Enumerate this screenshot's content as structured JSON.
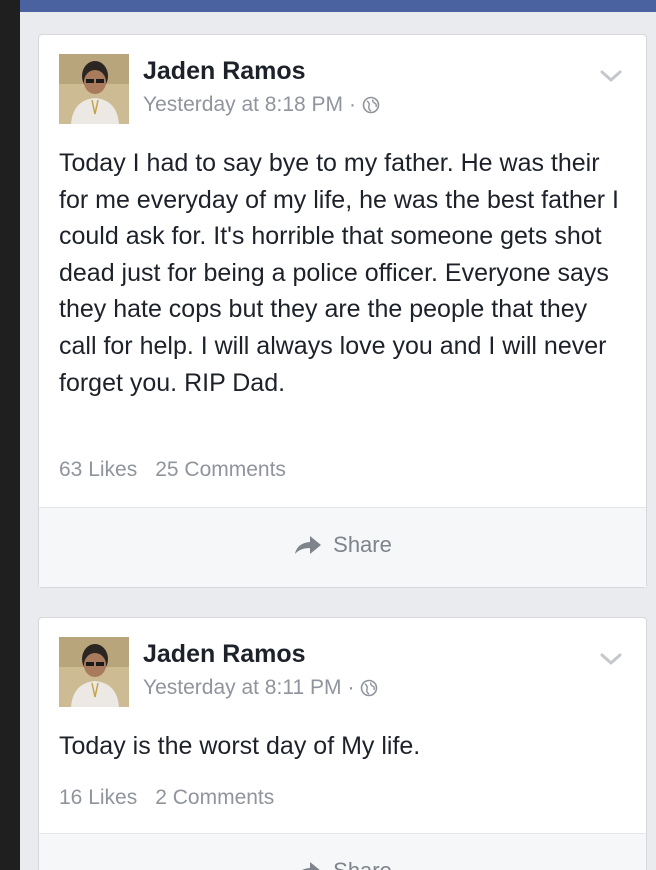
{
  "posts": [
    {
      "author": "Jaden Ramos",
      "timestamp": "Yesterday at 8:18 PM",
      "separator": "·",
      "privacy_icon": "globe-icon",
      "text": "Today I had to say bye to my father. He was their for me everyday of my life, he was the best father I could ask for. It's horrible that someone gets shot dead just for being a police officer. Everyone says they hate cops but they are the people that they call for help. I will always love you and I will never forget you. RIP Dad.",
      "likes": "63 Likes",
      "comments": "25 Comments",
      "share_label": "Share"
    },
    {
      "author": "Jaden Ramos",
      "timestamp": "Yesterday at 8:11 PM",
      "separator": "·",
      "privacy_icon": "globe-icon",
      "text": "Today is the worst day of My life.",
      "likes": "16 Likes",
      "comments": "2 Comments",
      "share_label": "Share"
    }
  ],
  "colors": {
    "top_bar": "#4b62a0",
    "background": "#e9ebee",
    "meta_text": "#90949c",
    "body_text": "#1d2129"
  }
}
